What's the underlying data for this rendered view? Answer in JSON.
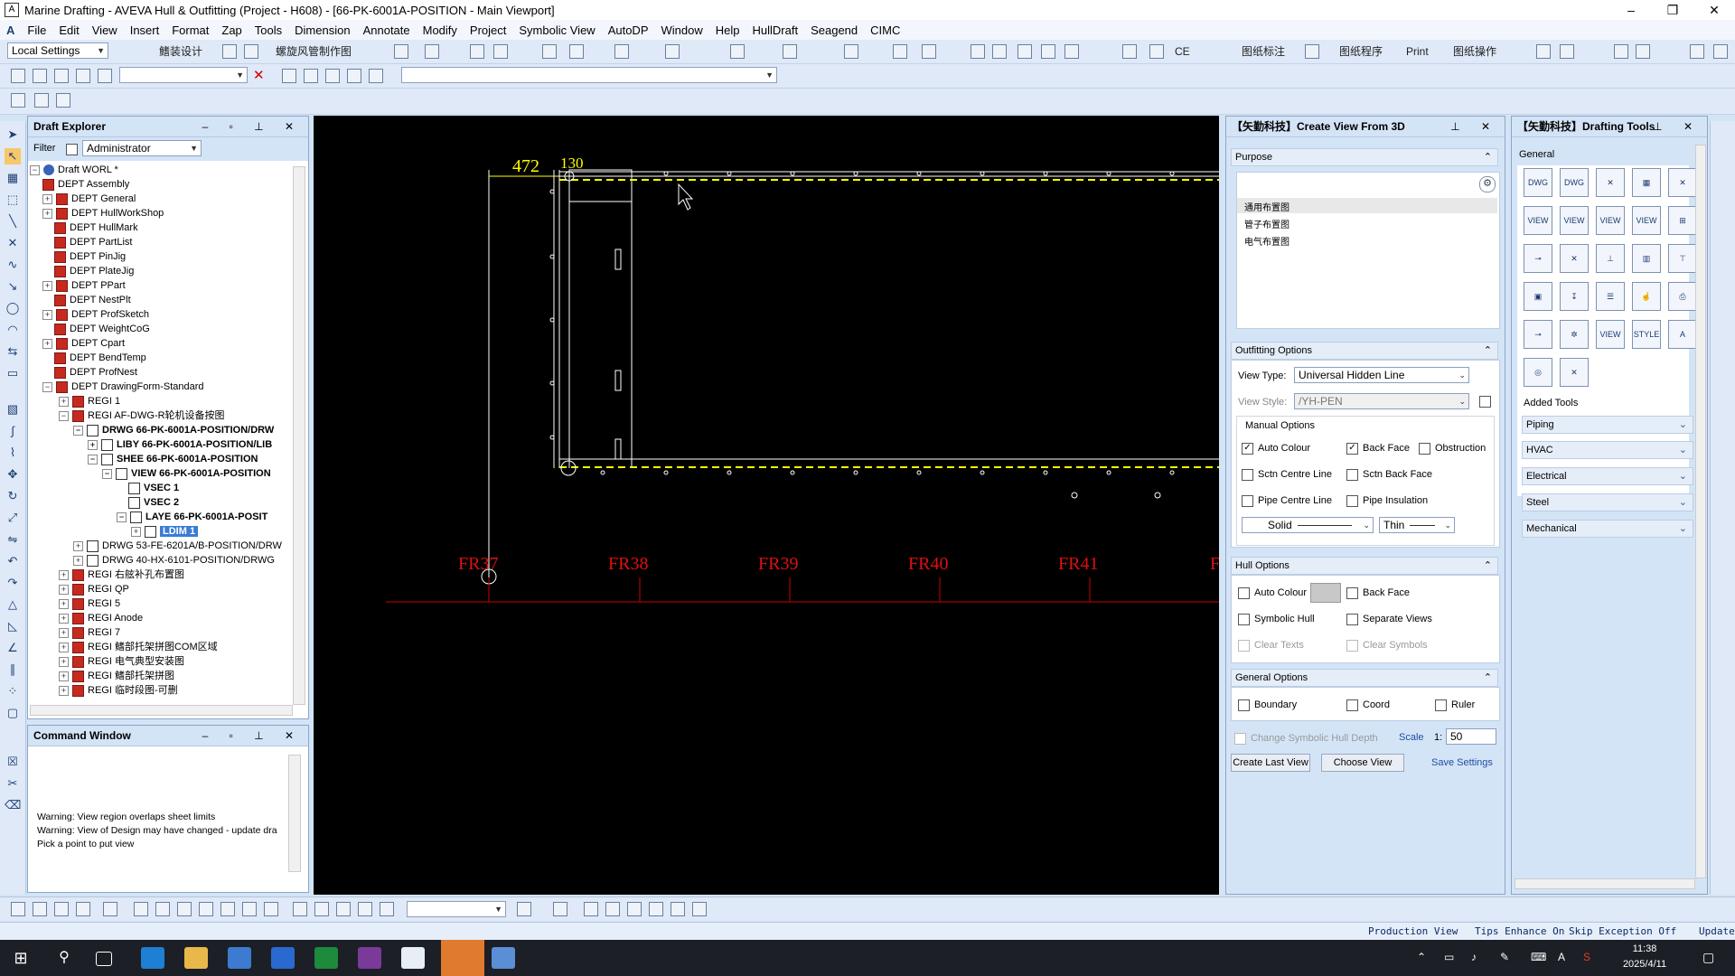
{
  "window": {
    "title": "Marine Drafting - AVEVA Hull & Outfitting (Project - H608) - [66-PK-6001A-POSITION - Main Viewport]",
    "minimize": "–",
    "restore": "❐",
    "close": "✕"
  },
  "menu": [
    "File",
    "Edit",
    "View",
    "Insert",
    "Format",
    "Zap",
    "Tools",
    "Dimension",
    "Annotate",
    "Modify",
    "Project",
    "Symbolic View",
    "AutoDP",
    "Window",
    "Help",
    "HullDraft",
    "Seagend",
    "CIMC"
  ],
  "toolbar1": {
    "settings": "Local Settings",
    "t1": "鳍装设计",
    "t2": "螺旋风管制作图",
    "t3": "CE",
    "t4": "图纸标注",
    "t5": "图纸程序",
    "t6": "Print",
    "t7": "图纸操作"
  },
  "draft_explorer": {
    "title": "Draft Explorer",
    "filter_label": "Filter",
    "filter_value": "Administrator",
    "nodes": [
      {
        "label": "Draft WORL *",
        "tog": "−"
      },
      {
        "label": "DEPT Assembly",
        "tog": ""
      },
      {
        "label": "DEPT General",
        "tog": "+"
      },
      {
        "label": "DEPT HullWorkShop",
        "tog": "+"
      },
      {
        "label": "DEPT HullMark",
        "tog": ""
      },
      {
        "label": "DEPT PartList",
        "tog": ""
      },
      {
        "label": "DEPT PinJig",
        "tog": ""
      },
      {
        "label": "DEPT PlateJig",
        "tog": ""
      },
      {
        "label": "DEPT PPart",
        "tog": "+"
      },
      {
        "label": "DEPT NestPlt",
        "tog": ""
      },
      {
        "label": "DEPT ProfSketch",
        "tog": "+"
      },
      {
        "label": "DEPT WeightCoG",
        "tog": ""
      },
      {
        "label": "DEPT Cpart",
        "tog": "+"
      },
      {
        "label": "DEPT BendTemp",
        "tog": ""
      },
      {
        "label": "DEPT ProfNest",
        "tog": ""
      },
      {
        "label": "DEPT DrawingForm-Standard",
        "tog": "−"
      },
      {
        "label": "REGI 1",
        "tog": "+"
      },
      {
        "label": "REGI AF-DWG-R轮机设备按图",
        "tog": "−"
      },
      {
        "label": "DRWG 66-PK-6001A-POSITION/DRW",
        "tog": "−"
      },
      {
        "label": "LIBY 66-PK-6001A-POSITION/LIB",
        "tog": "+"
      },
      {
        "label": "SHEE 66-PK-6001A-POSITION",
        "tog": "−"
      },
      {
        "label": "VIEW 66-PK-6001A-POSITION",
        "tog": "−"
      },
      {
        "label": "VSEC 1",
        "tog": ""
      },
      {
        "label": "VSEC 2",
        "tog": ""
      },
      {
        "label": "LAYE 66-PK-6001A-POSIT",
        "tog": "−"
      },
      {
        "label": "LDIM 1",
        "tog": "+"
      },
      {
        "label": "DRWG 53-FE-6201A/B-POSITION/DRW",
        "tog": "+"
      },
      {
        "label": "DRWG 40-HX-6101-POSITION/DRWG",
        "tog": "+"
      },
      {
        "label": "REGI 右舷补孔布置图",
        "tog": "+"
      },
      {
        "label": "REGI QP",
        "tog": "+"
      },
      {
        "label": "REGI 5",
        "tog": "+"
      },
      {
        "label": "REGI Anode",
        "tog": "+"
      },
      {
        "label": "REGI 7",
        "tog": "+"
      },
      {
        "label": "REGI 鳍部托架拼图COM区域",
        "tog": "+"
      },
      {
        "label": "REGI 电气典型安装图",
        "tog": "+"
      },
      {
        "label": "REGI 鳍部托架拼图",
        "tog": "+"
      },
      {
        "label": "REGI 临时段图-可删",
        "tog": "+"
      }
    ]
  },
  "command_window": {
    "title": "Command Window",
    "lines": [
      "Warning: View region overlaps sheet limits",
      "Warning: View of Design may have changed - update dra",
      "Pick a point to put view"
    ]
  },
  "viewport": {
    "dim1": "472",
    "dim2": "130",
    "frames": [
      "FR37",
      "FR38",
      "FR39",
      "FR40",
      "FR41"
    ]
  },
  "create_view": {
    "title": "【矢勤科技】Create View From 3D",
    "purpose_label": "Purpose",
    "purpose_items": [
      "通用布置图",
      "管子布置图",
      "电气布置图"
    ],
    "outfitting_label": "Outfitting Options",
    "view_type_label": "View Type:",
    "view_type_value": "Universal Hidden Line",
    "view_style_label": "View Style:",
    "view_style_value": "/YH-PEN",
    "manual_label": "Manual Options",
    "auto_colour": "Auto Colour",
    "back_face": "Back Face",
    "obstruction": "Obstruction",
    "sctn_centre": "Sctn Centre Line",
    "sctn_back": "Sctn Back Face",
    "pipe_centre": "Pipe Centre Line",
    "pipe_insul": "Pipe Insulation",
    "line_style": "Solid",
    "line_weight": "Thin",
    "hull_label": "Hull Options",
    "hull_auto_colour": "Auto Colour",
    "hull_back_face": "Back Face",
    "symbolic_hull": "Symbolic Hull",
    "separate_views": "Separate Views",
    "clear_texts": "Clear Texts",
    "clear_symbols": "Clear Symbols",
    "general_label": "General Options",
    "boundary": "Boundary",
    "coord": "Coord",
    "ruler": "Ruler",
    "change_depth": "Change Symbolic Hull Depth",
    "scale_label": "Scale",
    "scale_prefix": "1:",
    "scale_value": "50",
    "create_last": "Create Last View",
    "choose_view": "Choose View",
    "save_settings": "Save Settings"
  },
  "drafting_tools": {
    "title": "【矢勤科技】Drafting Tools",
    "general_label": "General",
    "added_tools_label": "Added Tools",
    "view_label": "VIEW",
    "style_label": "STYLE",
    "groups": [
      "Piping",
      "HVAC",
      "Electrical",
      "Steel",
      "Mechanical"
    ]
  },
  "status": {
    "s1": "Production View",
    "s2": "Tips Enhance On",
    "s3": "Skip Exception Off",
    "s4": "Update"
  },
  "taskbar": {
    "time": "11:38",
    "date": "2025/4/11"
  }
}
